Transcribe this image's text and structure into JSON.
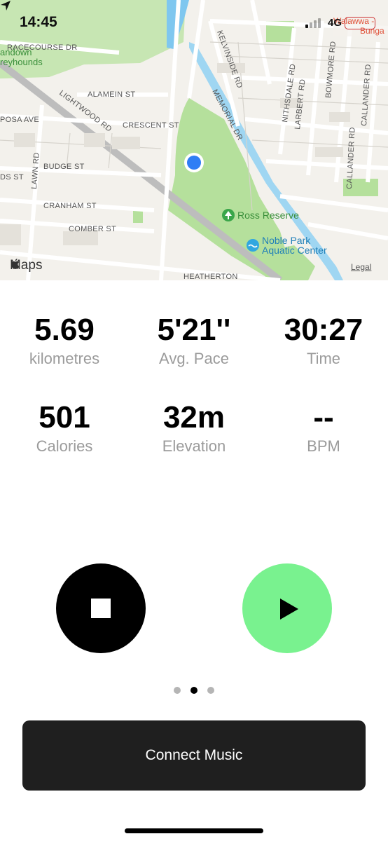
{
  "status_bar": {
    "time": "14:45",
    "network": "4G"
  },
  "map": {
    "attribution": "Maps",
    "legal_label": "Legal",
    "streets": [
      "RACECOURSE DR",
      "ALAMEIN ST",
      "LIGHTWOOD RD",
      "CRESCENT ST",
      "BUDGE ST",
      "CRANHAM ST",
      "COMBER ST",
      "HEATHERTON",
      "KELVINSIDE RD",
      "MEMORIAL DR",
      "NITHSDALE RD",
      "LARBERT RD",
      "BOWMORE RD",
      "CALLANDER RD",
      "LAWN RD",
      "POSA AVE",
      "DS ST"
    ],
    "places": {
      "sandown": [
        "andown",
        "reyhounds"
      ],
      "ross_reserve": "Ross Reserve",
      "aquatic": [
        "Noble Park",
        "Aquatic Center"
      ],
      "corner": [
        "Walawwa -",
        "Bunga"
      ]
    }
  },
  "stats": [
    {
      "value": "5.69",
      "label": "kilometres"
    },
    {
      "value": "5'21''",
      "label": "Avg. Pace"
    },
    {
      "value": "30:27",
      "label": "Time"
    },
    {
      "value": "501",
      "label": "Calories"
    },
    {
      "value": "32m",
      "label": "Elevation"
    },
    {
      "value": "--",
      "label": "BPM"
    }
  ],
  "controls": {
    "stop_icon": "stop-icon",
    "play_icon": "play-icon",
    "play_color": "#79f28f"
  },
  "pager": {
    "count": 3,
    "active_index": 1
  },
  "connect_music_label": "Connect Music"
}
